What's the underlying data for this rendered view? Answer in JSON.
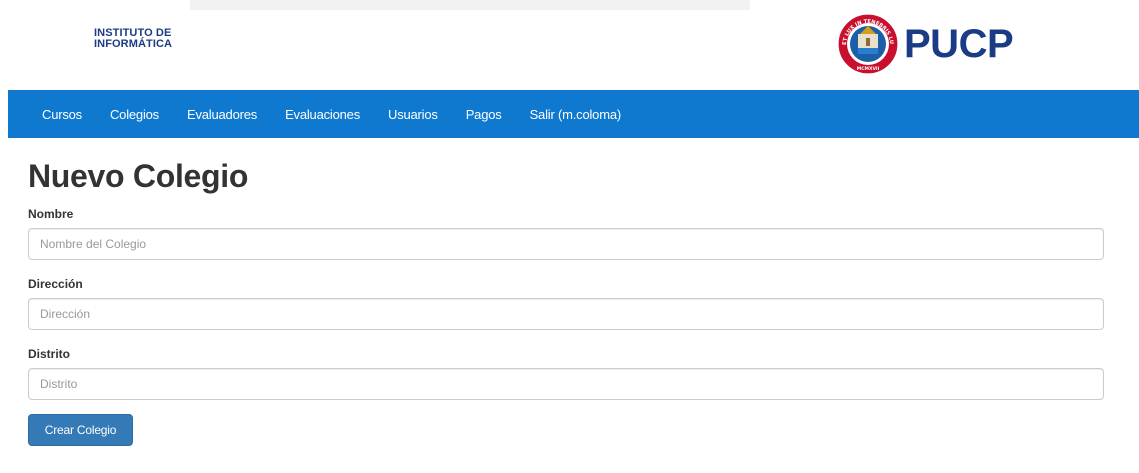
{
  "header": {
    "institute_line1": "INSTITUTO DE",
    "institute_line2": "INFORMÁTICA",
    "university_logo_text": "PUCP",
    "seal_motto": "ET LUX IN TENEBRIS LUCET",
    "seal_year": "MCMXVII",
    "brand_color": "#1b3c84"
  },
  "nav": {
    "background": "#0f79d0",
    "items": [
      {
        "label": "Cursos"
      },
      {
        "label": "Colegios"
      },
      {
        "label": "Evaluadores"
      },
      {
        "label": "Evaluaciones"
      },
      {
        "label": "Usuarios"
      },
      {
        "label": "Pagos"
      },
      {
        "label": "Salir (m.coloma)"
      }
    ]
  },
  "page": {
    "title": "Nuevo Colegio"
  },
  "form": {
    "fields": [
      {
        "label": "Nombre",
        "placeholder": "Nombre del Colegio",
        "value": ""
      },
      {
        "label": "Dirección",
        "placeholder": "Dirección",
        "value": ""
      },
      {
        "label": "Distrito",
        "placeholder": "Distrito",
        "value": ""
      }
    ],
    "submit_label": "Crear Colegio",
    "submit_color": "#337ab7"
  }
}
